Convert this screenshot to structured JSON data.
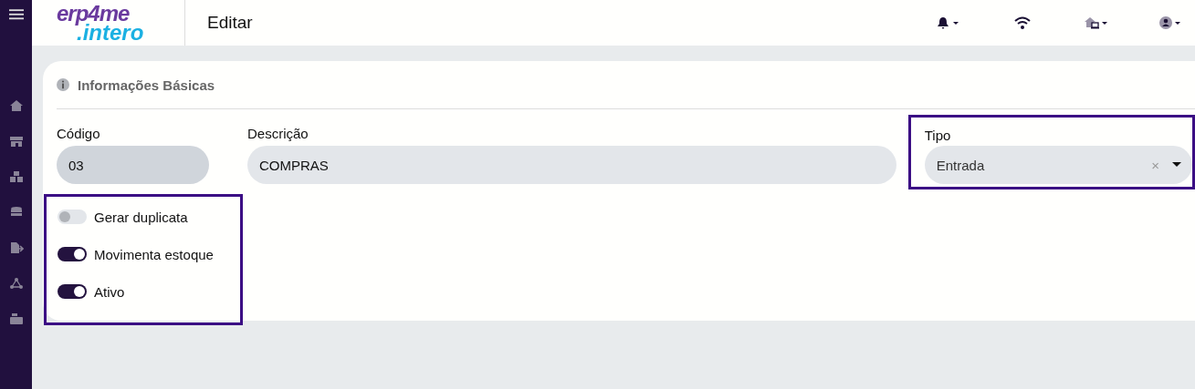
{
  "logo": {
    "top": "erp4me",
    "bottom": ".intero"
  },
  "header": {
    "title": "Editar"
  },
  "card": {
    "title": "Informações Básicas"
  },
  "fields": [
    {
      "kind": "text",
      "label": "Código",
      "value": "03",
      "focused": true
    },
    {
      "kind": "text",
      "label": "Descrição",
      "value": "COMPRAS",
      "focused": false
    },
    {
      "kind": "select",
      "label": "Tipo",
      "value": "Entrada",
      "clear": "×",
      "highlighted": true
    }
  ],
  "toggles": [
    {
      "label": "Gerar duplicata",
      "on": false
    },
    {
      "label": "Movimenta estoque",
      "on": true
    },
    {
      "label": "Ativo",
      "on": true
    }
  ]
}
